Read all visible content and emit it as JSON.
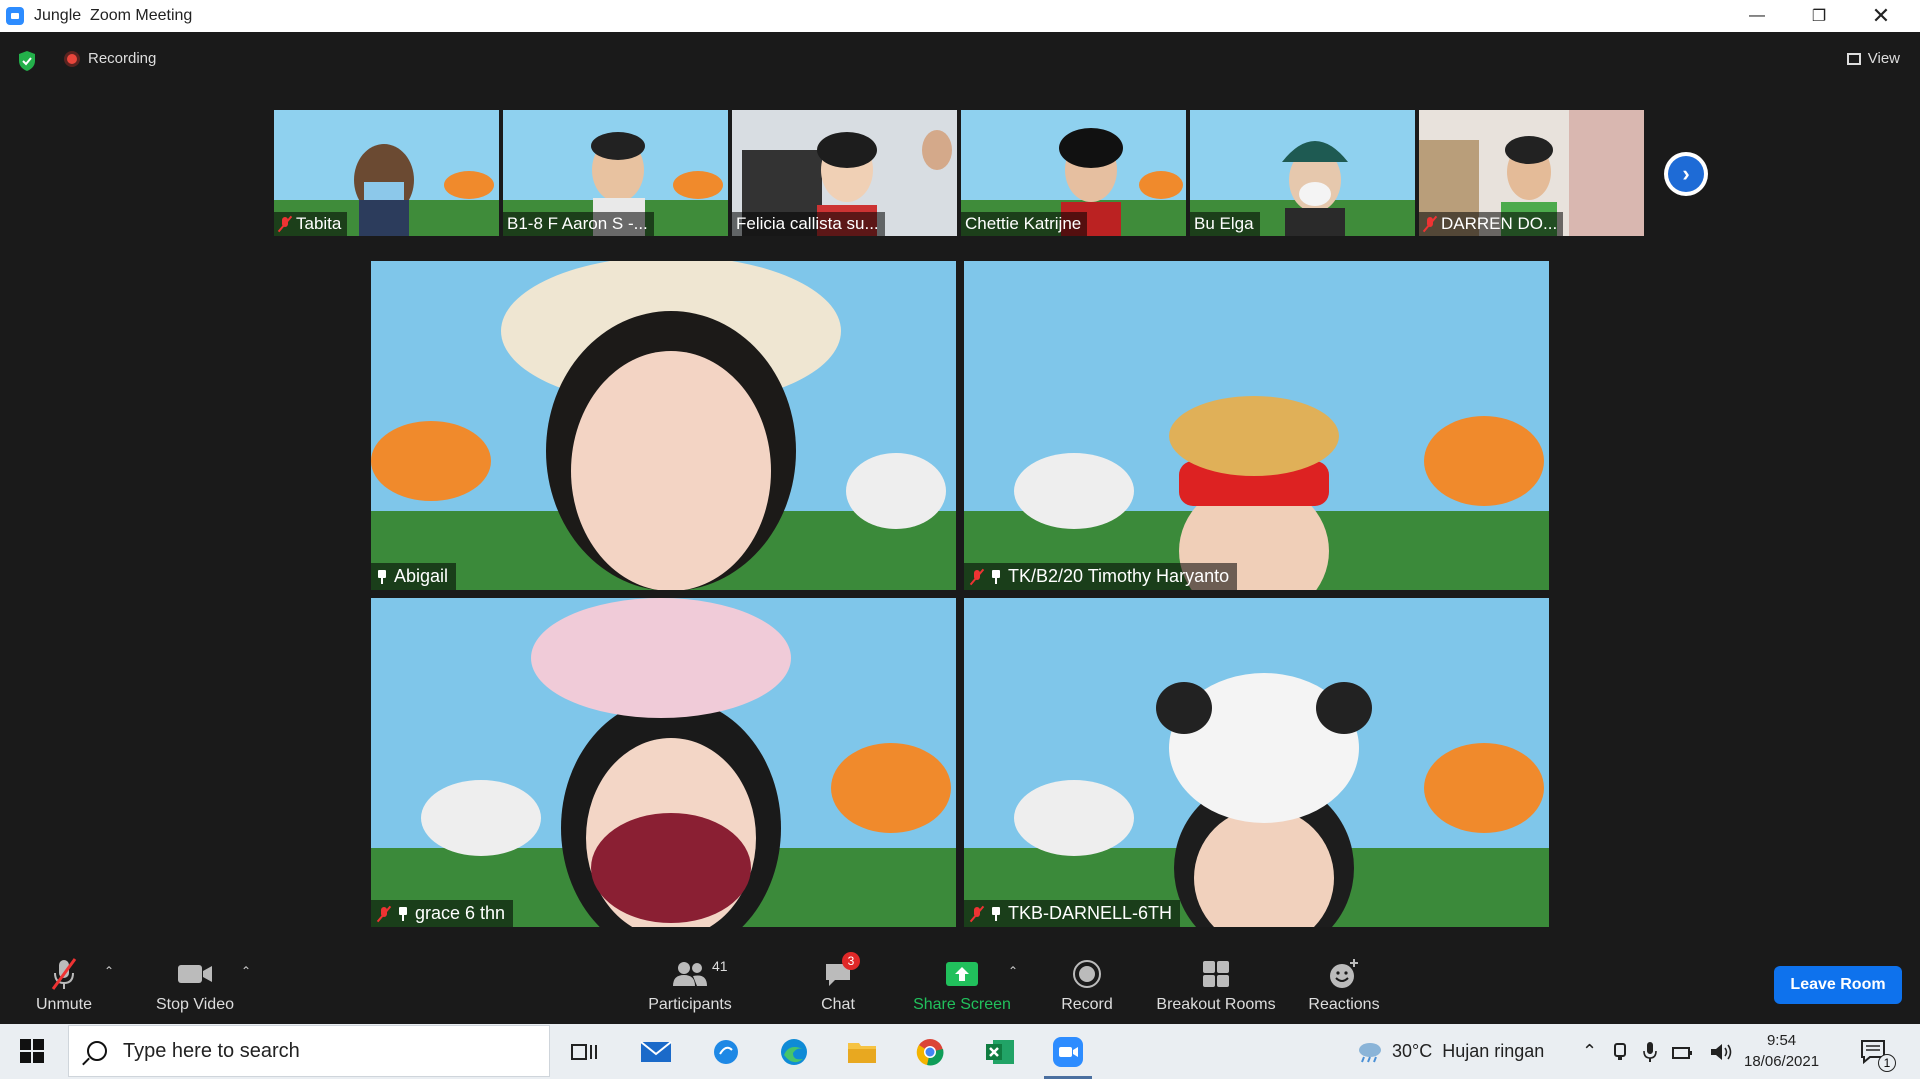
{
  "window": {
    "title_app": "Jungle",
    "title_main": "Zoom Meeting",
    "controls": [
      "minimize",
      "restore",
      "close"
    ]
  },
  "meeting": {
    "recording_label": "Recording",
    "view_label": "View"
  },
  "thumbnails": [
    {
      "name": "Tabita",
      "muted": true
    },
    {
      "name": "B1-8 F Aaron S -...",
      "muted": false
    },
    {
      "name": "Felicia callista su...",
      "muted": false
    },
    {
      "name": "Chettie Katrijne",
      "muted": false
    },
    {
      "name": "Bu Elga",
      "muted": false
    },
    {
      "name": "DARREN DO...",
      "muted": true
    }
  ],
  "tiles": [
    {
      "name": "Abigail",
      "muted": false,
      "pinned": true
    },
    {
      "name": "TK/B2/20 Timothy Haryanto",
      "muted": true,
      "pinned": true
    },
    {
      "name": "grace 6 thn",
      "muted": true,
      "pinned": true
    },
    {
      "name": "TKB-DARNELL-6TH",
      "muted": true,
      "pinned": true
    }
  ],
  "toolbar": {
    "unmute": "Unmute",
    "stop_video": "Stop Video",
    "participants": "Participants",
    "participants_count": "41",
    "chat": "Chat",
    "chat_badge": "3",
    "share_screen": "Share Screen",
    "record": "Record",
    "breakout_rooms": "Breakout Rooms",
    "reactions": "Reactions",
    "leave": "Leave Room"
  },
  "taskbar": {
    "search_placeholder": "Type here to search",
    "weather_temp": "30°C",
    "weather_desc": "Hujan ringan",
    "time": "9:54",
    "date": "18/06/2021",
    "notification_count": "1"
  },
  "colors": {
    "zoom_blue": "#0e72ed",
    "share_green": "#21c05c",
    "mute_red": "#e33333",
    "chat_badge_red": "#e02828"
  }
}
